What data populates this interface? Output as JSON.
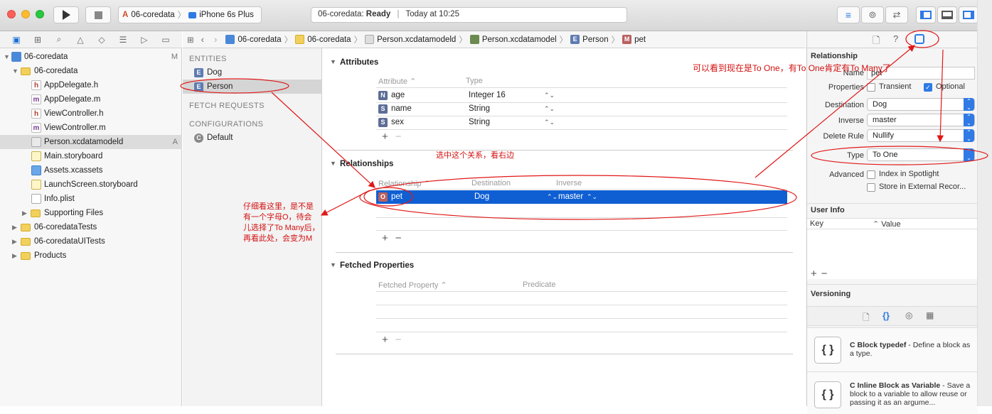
{
  "toolbar": {
    "scheme": "06-coredata",
    "device": "iPhone 6s Plus",
    "status_project": "06-coredata:",
    "status_state": "Ready",
    "status_time": "Today at 10:25"
  },
  "jumpbar": {
    "crumbs": [
      "06-coredata",
      "06-coredata",
      "Person.xcdatamodeld",
      "Person.xcdatamodel",
      "Person",
      "pet"
    ]
  },
  "navigator": {
    "items": [
      {
        "label": "06-coredata",
        "badge": "M"
      },
      {
        "label": "06-coredata",
        "badge": ""
      },
      {
        "label": "AppDelegate.h",
        "badge": ""
      },
      {
        "label": "AppDelegate.m",
        "badge": ""
      },
      {
        "label": "ViewController.h",
        "badge": ""
      },
      {
        "label": "ViewController.m",
        "badge": ""
      },
      {
        "label": "Person.xcdatamodeld",
        "badge": "A"
      },
      {
        "label": "Main.storyboard",
        "badge": ""
      },
      {
        "label": "Assets.xcassets",
        "badge": ""
      },
      {
        "label": "LaunchScreen.storyboard",
        "badge": ""
      },
      {
        "label": "Info.plist",
        "badge": ""
      },
      {
        "label": "Supporting Files",
        "badge": ""
      },
      {
        "label": "06-coredataTests",
        "badge": ""
      },
      {
        "label": "06-coredataUITests",
        "badge": ""
      },
      {
        "label": "Products",
        "badge": ""
      }
    ]
  },
  "entities_panel": {
    "entities_header": "ENTITIES",
    "entities": [
      "Dog",
      "Person"
    ],
    "fetch_header": "FETCH REQUESTS",
    "config_header": "CONFIGURATIONS",
    "configs": [
      "Default"
    ]
  },
  "editor": {
    "attributes_title": "Attributes",
    "attr_col_name": "Attribute",
    "attr_col_type": "Type",
    "attributes": [
      {
        "badge": "N",
        "name": "age",
        "type": "Integer 16"
      },
      {
        "badge": "S",
        "name": "name",
        "type": "String"
      },
      {
        "badge": "S",
        "name": "sex",
        "type": "String"
      }
    ],
    "relationships_title": "Relationships",
    "rel_col_name": "Relationship",
    "rel_col_dest": "Destination",
    "rel_col_inverse": "Inverse",
    "relationships": [
      {
        "badge": "O",
        "name": "pet",
        "destination": "Dog",
        "inverse": "master"
      }
    ],
    "fetched_title": "Fetched Properties",
    "fp_col_name": "Fetched Property",
    "fp_col_pred": "Predicate",
    "plus": "+",
    "minus": "−"
  },
  "inspector": {
    "section_relationship": "Relationship",
    "name_label": "Name",
    "name_value": "pet",
    "properties_label": "Properties",
    "transient_label": "Transient",
    "optional_label": "Optional",
    "destination_label": "Destination",
    "destination_value": "Dog",
    "inverse_label": "Inverse",
    "inverse_value": "master",
    "delete_rule_label": "Delete Rule",
    "delete_rule_value": "Nullify",
    "type_label": "Type",
    "type_value": "To One",
    "advanced_label": "Advanced",
    "index_label": "Index in Spotlight",
    "external_label": "Store in External Recor...",
    "user_info_title": "User Info",
    "key_col": "Key",
    "value_col": "Value",
    "versioning_title": "Versioning",
    "library": [
      {
        "icon": "{ }",
        "title": "C Block typedef",
        "desc": " - Define a block as a type."
      },
      {
        "icon": "{ }",
        "title": "C Inline Block as Variable",
        "desc": " - Save a block to a variable to allow reuse or passing it as an argume..."
      }
    ]
  },
  "annotations": {
    "top_right": "可以看到现在是To One，有To One肯定有To Many了",
    "middle": "选中这个关系，看右边",
    "left_1": "仔细看这里，是不是",
    "left_2": "有一个字母O，待会",
    "left_3": "儿选择了To Many后，",
    "left_4": "再看此处，会变为M"
  },
  "colors": {
    "selection_blue": "#0f5fd3",
    "annotation_red": "#d31010",
    "accent_blue": "#2f7ae5"
  }
}
